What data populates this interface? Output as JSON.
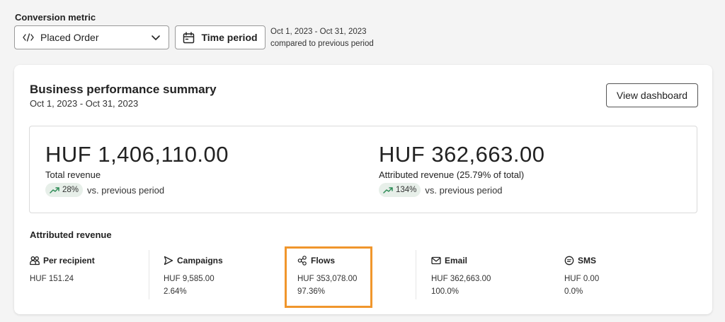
{
  "conversion": {
    "label": "Conversion metric",
    "selected": "Placed Order",
    "time_button": "Time period",
    "date_range": "Oct 1, 2023 - Oct 31, 2023",
    "comparison": "compared to previous period"
  },
  "summary": {
    "title": "Business performance summary",
    "date_range": "Oct 1, 2023 - Oct 31, 2023",
    "view_button": "View dashboard",
    "total": {
      "value": "HUF 1,406,110.00",
      "label": "Total revenue",
      "change": "28%",
      "change_label": "vs. previous period"
    },
    "attributed": {
      "value": "HUF 362,663.00",
      "label": "Attributed revenue (25.79% of total)",
      "change": "134%",
      "change_label": "vs. previous period"
    }
  },
  "attributed_revenue": {
    "title": "Attributed revenue",
    "metrics": [
      {
        "icon": "people-icon",
        "label": "Per recipient",
        "value": "HUF 151.24",
        "percent": ""
      },
      {
        "icon": "send-icon",
        "label": "Campaigns",
        "value": "HUF 9,585.00",
        "percent": "2.64%"
      },
      {
        "icon": "flows-icon",
        "label": "Flows",
        "value": "HUF 353,078.00",
        "percent": "97.36%"
      },
      {
        "icon": "envelope-icon",
        "label": "Email",
        "value": "HUF 362,663.00",
        "percent": "100.0%"
      },
      {
        "icon": "sms-icon",
        "label": "SMS",
        "value": "HUF 0.00",
        "percent": "0.0%"
      }
    ]
  },
  "colors": {
    "highlight": "#f0962c",
    "badge_bg": "#e7efe9",
    "trend_up": "#2f8c57"
  }
}
